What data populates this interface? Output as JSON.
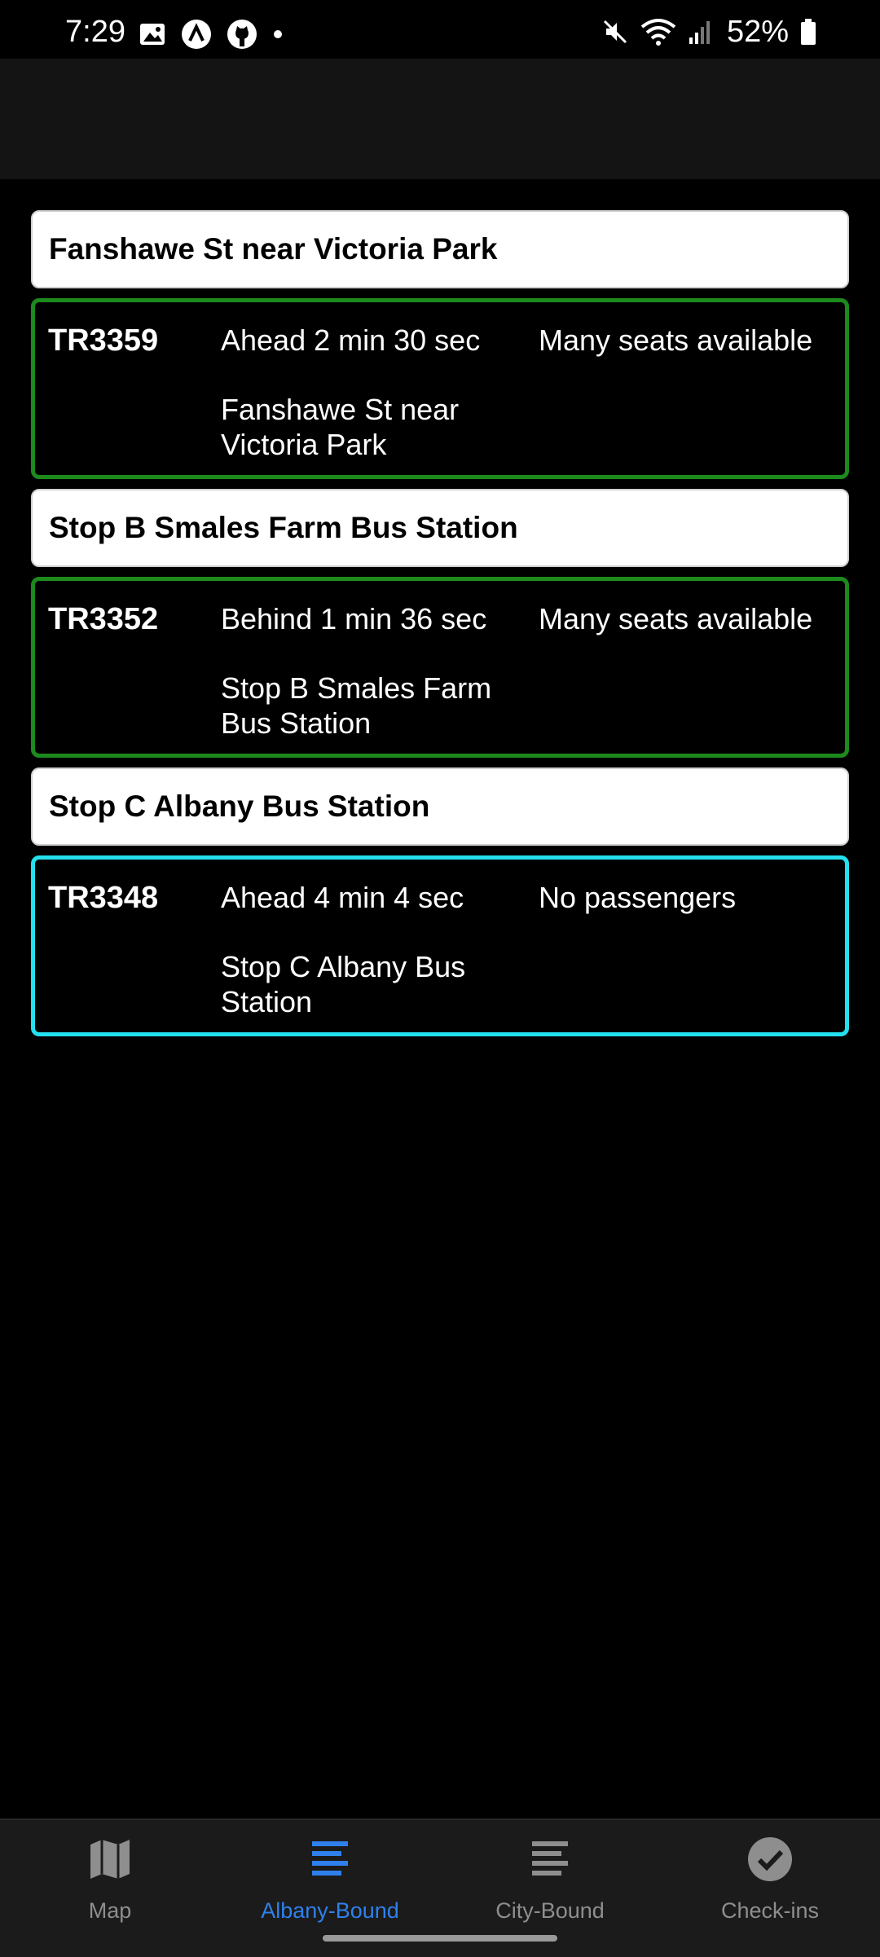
{
  "status_bar": {
    "time": "7:29",
    "battery": "52%",
    "icons": [
      "image-icon",
      "app-logo-icon",
      "github-icon",
      "dot-icon",
      "mute-icon",
      "wifi-icon",
      "signal-icon",
      "battery-icon"
    ]
  },
  "stops": [
    {
      "title": "Fanshawe St near Victoria Park",
      "vehicle": {
        "id": "TR3359",
        "delay": "Ahead 2 min 30 sec",
        "occupancy": "Many seats available",
        "stop_name": "Fanshawe St near Victoria Park",
        "border_color": "#1c8a1c"
      }
    },
    {
      "title": "Stop B Smales Farm Bus Station",
      "vehicle": {
        "id": "TR3352",
        "delay": "Behind 1 min 36 sec",
        "occupancy": "Many seats available",
        "stop_name": "Stop B Smales Farm Bus Station",
        "border_color": "#1c8a1c"
      }
    },
    {
      "title": "Stop C Albany Bus Station",
      "vehicle": {
        "id": "TR3348",
        "delay": "Ahead 4 min 4 sec",
        "occupancy": "No passengers",
        "stop_name": "Stop C Albany Bus Station",
        "border_color": "#24e0ef"
      }
    }
  ],
  "nav": {
    "items": [
      {
        "label": "Map",
        "icon": "map-icon",
        "active": false
      },
      {
        "label": "Albany-Bound",
        "icon": "list-icon",
        "active": true
      },
      {
        "label": "City-Bound",
        "icon": "list-icon",
        "active": false
      },
      {
        "label": "Check-ins",
        "icon": "check-circle-icon",
        "active": false
      }
    ]
  },
  "colors": {
    "accent": "#2f80ed",
    "on_time_border": "#1c8a1c",
    "empty_border": "#24e0ef",
    "nav_inactive": "#8e8e8e"
  }
}
